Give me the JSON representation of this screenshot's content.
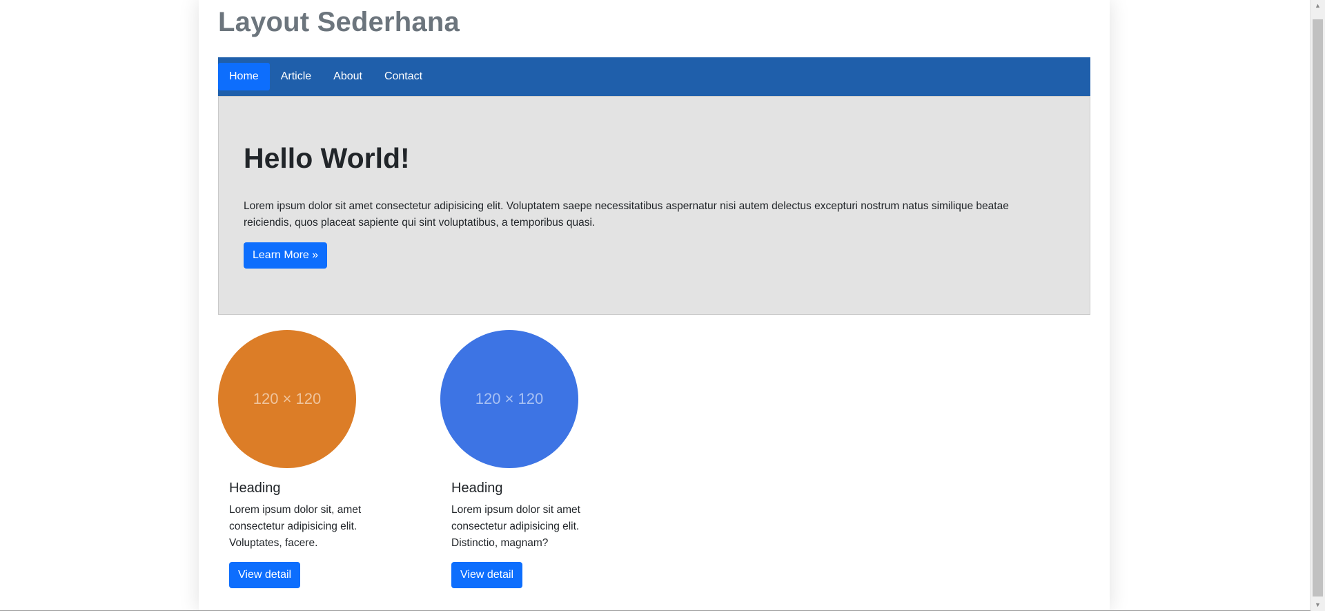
{
  "header": {
    "title": "Layout Sederhana"
  },
  "nav": {
    "items": [
      {
        "label": "Home"
      },
      {
        "label": "Article"
      },
      {
        "label": "About"
      },
      {
        "label": "Contact"
      }
    ]
  },
  "hero": {
    "heading": "Hello World!",
    "text": "Lorem ipsum dolor sit amet consectetur adipisicing elit. Voluptatem saepe necessitatibus aspernatur nisi autem delectus excepturi nostrum natus similique beatae reiciendis, quos placeat sapiente qui sint voluptatibus, a temporibus quasi.",
    "button_label": "Learn More »"
  },
  "cards": [
    {
      "placeholder_text": "120 × 120",
      "heading": "Heading",
      "text": "Lorem ipsum dolor sit, amet consectetur adipisicing elit. Voluptates, facere.",
      "button_label": "View detail"
    },
    {
      "placeholder_text": "120 × 120",
      "heading": "Heading",
      "text": "Lorem ipsum dolor sit amet consectetur adipisicing elit. Distinctio, magnam?",
      "button_label": "View detail"
    }
  ],
  "colors": {
    "navbar": "#1f5fab",
    "nav_active": "#0d6efd",
    "jumbotron_bg": "#e3e3e3",
    "button": "#0d6efd",
    "card1_circle": "#dc7d27",
    "card2_circle": "#3d74e4",
    "title": "#6c757d"
  },
  "icons": {
    "scroll_up": "scroll-up-arrow-icon",
    "scroll_down": "scroll-down-arrow-icon"
  }
}
